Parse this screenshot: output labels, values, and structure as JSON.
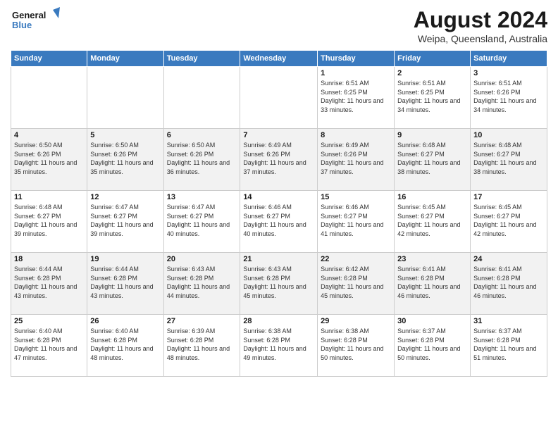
{
  "logo": {
    "line1": "General",
    "line2": "Blue"
  },
  "title": "August 2024",
  "subtitle": "Weipa, Queensland, Australia",
  "weekdays": [
    "Sunday",
    "Monday",
    "Tuesday",
    "Wednesday",
    "Thursday",
    "Friday",
    "Saturday"
  ],
  "weeks": [
    [
      {
        "day": "",
        "info": ""
      },
      {
        "day": "",
        "info": ""
      },
      {
        "day": "",
        "info": ""
      },
      {
        "day": "",
        "info": ""
      },
      {
        "day": "1",
        "info": "Sunrise: 6:51 AM\nSunset: 6:25 PM\nDaylight: 11 hours and 33 minutes."
      },
      {
        "day": "2",
        "info": "Sunrise: 6:51 AM\nSunset: 6:25 PM\nDaylight: 11 hours and 34 minutes."
      },
      {
        "day": "3",
        "info": "Sunrise: 6:51 AM\nSunset: 6:26 PM\nDaylight: 11 hours and 34 minutes."
      }
    ],
    [
      {
        "day": "4",
        "info": "Sunrise: 6:50 AM\nSunset: 6:26 PM\nDaylight: 11 hours and 35 minutes."
      },
      {
        "day": "5",
        "info": "Sunrise: 6:50 AM\nSunset: 6:26 PM\nDaylight: 11 hours and 35 minutes."
      },
      {
        "day": "6",
        "info": "Sunrise: 6:50 AM\nSunset: 6:26 PM\nDaylight: 11 hours and 36 minutes."
      },
      {
        "day": "7",
        "info": "Sunrise: 6:49 AM\nSunset: 6:26 PM\nDaylight: 11 hours and 37 minutes."
      },
      {
        "day": "8",
        "info": "Sunrise: 6:49 AM\nSunset: 6:26 PM\nDaylight: 11 hours and 37 minutes."
      },
      {
        "day": "9",
        "info": "Sunrise: 6:48 AM\nSunset: 6:27 PM\nDaylight: 11 hours and 38 minutes."
      },
      {
        "day": "10",
        "info": "Sunrise: 6:48 AM\nSunset: 6:27 PM\nDaylight: 11 hours and 38 minutes."
      }
    ],
    [
      {
        "day": "11",
        "info": "Sunrise: 6:48 AM\nSunset: 6:27 PM\nDaylight: 11 hours and 39 minutes."
      },
      {
        "day": "12",
        "info": "Sunrise: 6:47 AM\nSunset: 6:27 PM\nDaylight: 11 hours and 39 minutes."
      },
      {
        "day": "13",
        "info": "Sunrise: 6:47 AM\nSunset: 6:27 PM\nDaylight: 11 hours and 40 minutes."
      },
      {
        "day": "14",
        "info": "Sunrise: 6:46 AM\nSunset: 6:27 PM\nDaylight: 11 hours and 40 minutes."
      },
      {
        "day": "15",
        "info": "Sunrise: 6:46 AM\nSunset: 6:27 PM\nDaylight: 11 hours and 41 minutes."
      },
      {
        "day": "16",
        "info": "Sunrise: 6:45 AM\nSunset: 6:27 PM\nDaylight: 11 hours and 42 minutes."
      },
      {
        "day": "17",
        "info": "Sunrise: 6:45 AM\nSunset: 6:27 PM\nDaylight: 11 hours and 42 minutes."
      }
    ],
    [
      {
        "day": "18",
        "info": "Sunrise: 6:44 AM\nSunset: 6:28 PM\nDaylight: 11 hours and 43 minutes."
      },
      {
        "day": "19",
        "info": "Sunrise: 6:44 AM\nSunset: 6:28 PM\nDaylight: 11 hours and 43 minutes."
      },
      {
        "day": "20",
        "info": "Sunrise: 6:43 AM\nSunset: 6:28 PM\nDaylight: 11 hours and 44 minutes."
      },
      {
        "day": "21",
        "info": "Sunrise: 6:43 AM\nSunset: 6:28 PM\nDaylight: 11 hours and 45 minutes."
      },
      {
        "day": "22",
        "info": "Sunrise: 6:42 AM\nSunset: 6:28 PM\nDaylight: 11 hours and 45 minutes."
      },
      {
        "day": "23",
        "info": "Sunrise: 6:41 AM\nSunset: 6:28 PM\nDaylight: 11 hours and 46 minutes."
      },
      {
        "day": "24",
        "info": "Sunrise: 6:41 AM\nSunset: 6:28 PM\nDaylight: 11 hours and 46 minutes."
      }
    ],
    [
      {
        "day": "25",
        "info": "Sunrise: 6:40 AM\nSunset: 6:28 PM\nDaylight: 11 hours and 47 minutes."
      },
      {
        "day": "26",
        "info": "Sunrise: 6:40 AM\nSunset: 6:28 PM\nDaylight: 11 hours and 48 minutes."
      },
      {
        "day": "27",
        "info": "Sunrise: 6:39 AM\nSunset: 6:28 PM\nDaylight: 11 hours and 48 minutes."
      },
      {
        "day": "28",
        "info": "Sunrise: 6:38 AM\nSunset: 6:28 PM\nDaylight: 11 hours and 49 minutes."
      },
      {
        "day": "29",
        "info": "Sunrise: 6:38 AM\nSunset: 6:28 PM\nDaylight: 11 hours and 50 minutes."
      },
      {
        "day": "30",
        "info": "Sunrise: 6:37 AM\nSunset: 6:28 PM\nDaylight: 11 hours and 50 minutes."
      },
      {
        "day": "31",
        "info": "Sunrise: 6:37 AM\nSunset: 6:28 PM\nDaylight: 11 hours and 51 minutes."
      }
    ]
  ]
}
